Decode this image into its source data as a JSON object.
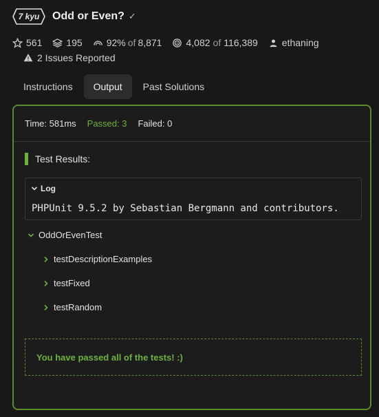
{
  "kata": {
    "rank": "7 kyu",
    "title": "Odd or Even?",
    "stars": "561",
    "collections": "195",
    "satisfaction_percent": "92%",
    "satisfaction_of": "of",
    "satisfaction_total": "8,871",
    "completed": "4,082",
    "completed_of": "of",
    "attempts": "116,389",
    "author": "ethaning",
    "issues": "2 Issues Reported"
  },
  "tabs": [
    "Instructions",
    "Output",
    "Past Solutions"
  ],
  "active_tab": "Output",
  "output": {
    "time": "Time: 581ms",
    "passed": "Passed: 3",
    "failed": "Failed: 0",
    "results_heading": "Test Results:",
    "log_label": "Log",
    "log_text": "PHPUnit 9.5.2 by Sebastian Bergmann and contributors.",
    "suite": "OddOrEvenTest",
    "tests": [
      "testDescriptionExamples",
      "testFixed",
      "testRandom"
    ],
    "success_message": "You have passed all of the tests! :)"
  },
  "colors": {
    "accent_green": "#6fb13c",
    "panel_border": "#5d8a2c",
    "background": "#181818"
  }
}
